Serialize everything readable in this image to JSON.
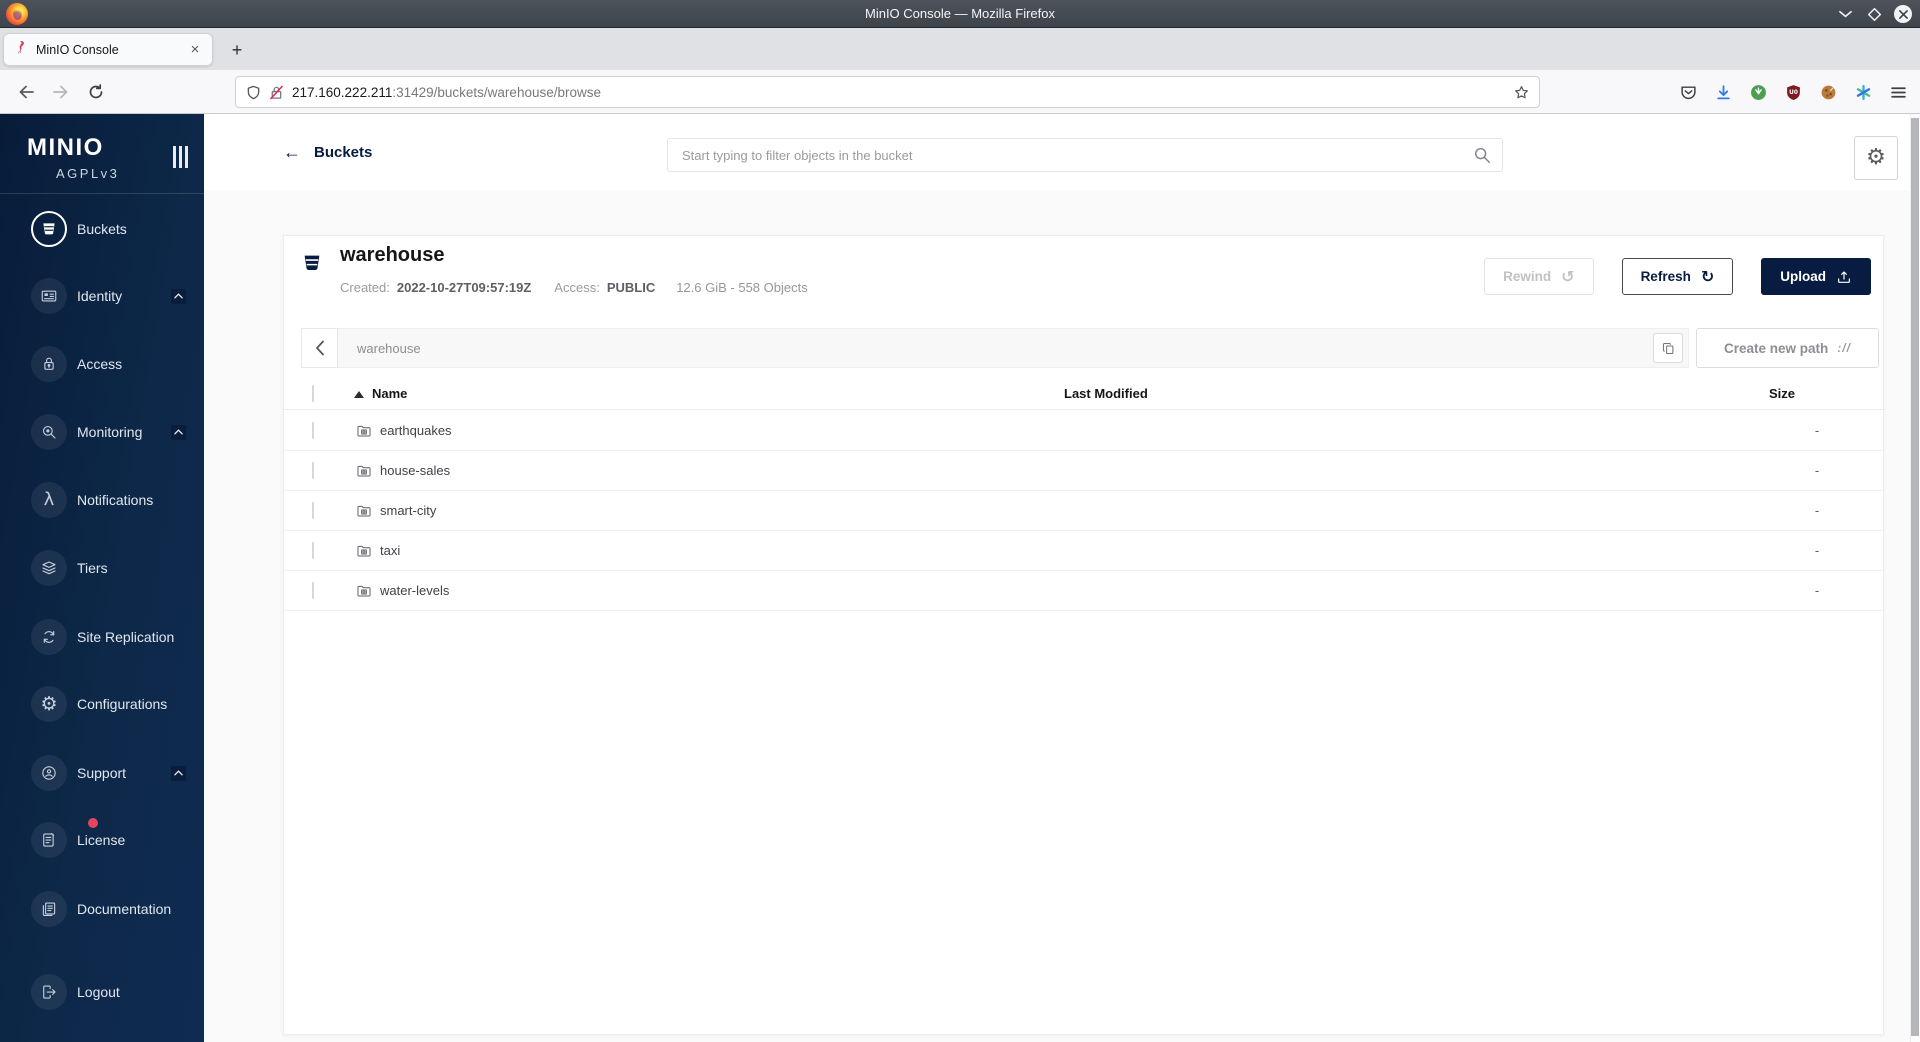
{
  "window": {
    "title": "MinIO Console — Mozilla Firefox"
  },
  "browser": {
    "tab_title": "MinIO Console",
    "tab_close": "×",
    "new_tab": "+",
    "url_host": "217.160.222.211",
    "url_path": ":31429/buckets/warehouse/browse"
  },
  "sidebar": {
    "logo": "MINIO",
    "license_tag": "AGPLv3",
    "items": [
      {
        "label": "Buckets",
        "icon": "bucket-icon",
        "active": true,
        "expandable": false,
        "badge": false
      },
      {
        "label": "Identity",
        "icon": "id-card-icon",
        "active": false,
        "expandable": true,
        "badge": false
      },
      {
        "label": "Access",
        "icon": "lock-icon",
        "active": false,
        "expandable": false,
        "badge": false
      },
      {
        "label": "Monitoring",
        "icon": "monitor-search-icon",
        "active": false,
        "expandable": true,
        "badge": false
      },
      {
        "label": "Notifications",
        "icon": "lambda-icon",
        "active": false,
        "expandable": false,
        "badge": false
      },
      {
        "label": "Tiers",
        "icon": "layers-icon",
        "active": false,
        "expandable": false,
        "badge": false
      },
      {
        "label": "Site Replication",
        "icon": "replication-icon",
        "active": false,
        "expandable": false,
        "badge": false
      },
      {
        "label": "Configurations",
        "icon": "gear-icon",
        "active": false,
        "expandable": false,
        "badge": false
      },
      {
        "label": "Support",
        "icon": "support-icon",
        "active": false,
        "expandable": true,
        "badge": false
      },
      {
        "label": "License",
        "icon": "license-icon",
        "active": false,
        "expandable": false,
        "badge": true
      },
      {
        "label": "Documentation",
        "icon": "documentation-icon",
        "active": false,
        "expandable": false,
        "badge": false
      },
      {
        "label": "Logout",
        "icon": "logout-icon",
        "active": false,
        "expandable": false,
        "badge": false
      }
    ]
  },
  "header": {
    "back_label": "Buckets",
    "search_placeholder": "Start typing to filter objects in the bucket"
  },
  "bucket": {
    "name": "warehouse",
    "created_label": "Created:",
    "created_value": "2022-10-27T09:57:19Z",
    "access_label": "Access:",
    "access_value": "PUBLIC",
    "usage_summary": "12.6 GiB - 558 Objects",
    "rewind_label": "Rewind",
    "refresh_label": "Refresh",
    "upload_label": "Upload"
  },
  "path_bar": {
    "current_path": "warehouse",
    "create_path_label": "Create new path",
    "create_path_icon": "://"
  },
  "objects_table": {
    "columns": {
      "name": "Name",
      "last_modified": "Last Modified",
      "size": "Size"
    },
    "rows": [
      {
        "name": "earthquakes",
        "last_modified": "",
        "size": "-"
      },
      {
        "name": "house-sales",
        "last_modified": "",
        "size": "-"
      },
      {
        "name": "smart-city",
        "last_modified": "",
        "size": "-"
      },
      {
        "name": "taxi",
        "last_modified": "",
        "size": "-"
      },
      {
        "name": "water-levels",
        "last_modified": "",
        "size": "-"
      }
    ]
  },
  "colors": {
    "accent_navy": "#081C42",
    "badge_red": "#e34560"
  }
}
